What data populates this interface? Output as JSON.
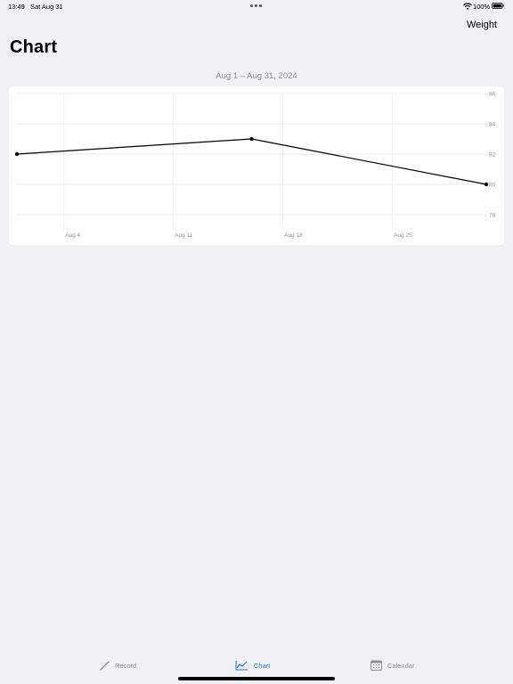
{
  "status_bar": {
    "time": "13:49",
    "date": "Sat Aug 31",
    "battery": "100%",
    "icons": [
      "more-dots-icon",
      "wifi-icon",
      "battery-icon"
    ]
  },
  "nav": {
    "right_button": "Weight",
    "title": "Chart"
  },
  "date_range": "Aug 1 – Aug 31, 2024",
  "colors": {
    "background": "#f1f0f5",
    "accent": "#1e7ad9",
    "line": "#000000",
    "secondary_text": "#8e8e93"
  },
  "chart_data": {
    "type": "line",
    "title": "",
    "xlabel": "",
    "ylabel": "",
    "xlim": [
      "2024-08-01",
      "2024-08-31"
    ],
    "ylim": [
      78,
      86
    ],
    "x_ticks": [
      "Aug 4",
      "Aug 11",
      "Aug 18",
      "Aug 25"
    ],
    "x_tick_dates": [
      "2024-08-04",
      "2024-08-11",
      "2024-08-18",
      "2024-08-25"
    ],
    "y_ticks": [
      "86",
      "84",
      "82",
      "80",
      "78"
    ],
    "y_tick_values": [
      86,
      84,
      82,
      80,
      78
    ],
    "grid": true,
    "series": [
      {
        "points": [
          {
            "x": "2024-08-01",
            "y": 82
          },
          {
            "x": "2024-08-16",
            "y": 83
          },
          {
            "x": "2024-08-31",
            "y": 80
          }
        ]
      }
    ]
  },
  "tab_bar": {
    "tabs": [
      {
        "label": "Record",
        "icon": "pencil-icon",
        "active": false
      },
      {
        "label": "Chart",
        "icon": "chart-icon",
        "active": true
      },
      {
        "label": "Calendar",
        "icon": "calendar-icon",
        "active": false
      }
    ]
  }
}
